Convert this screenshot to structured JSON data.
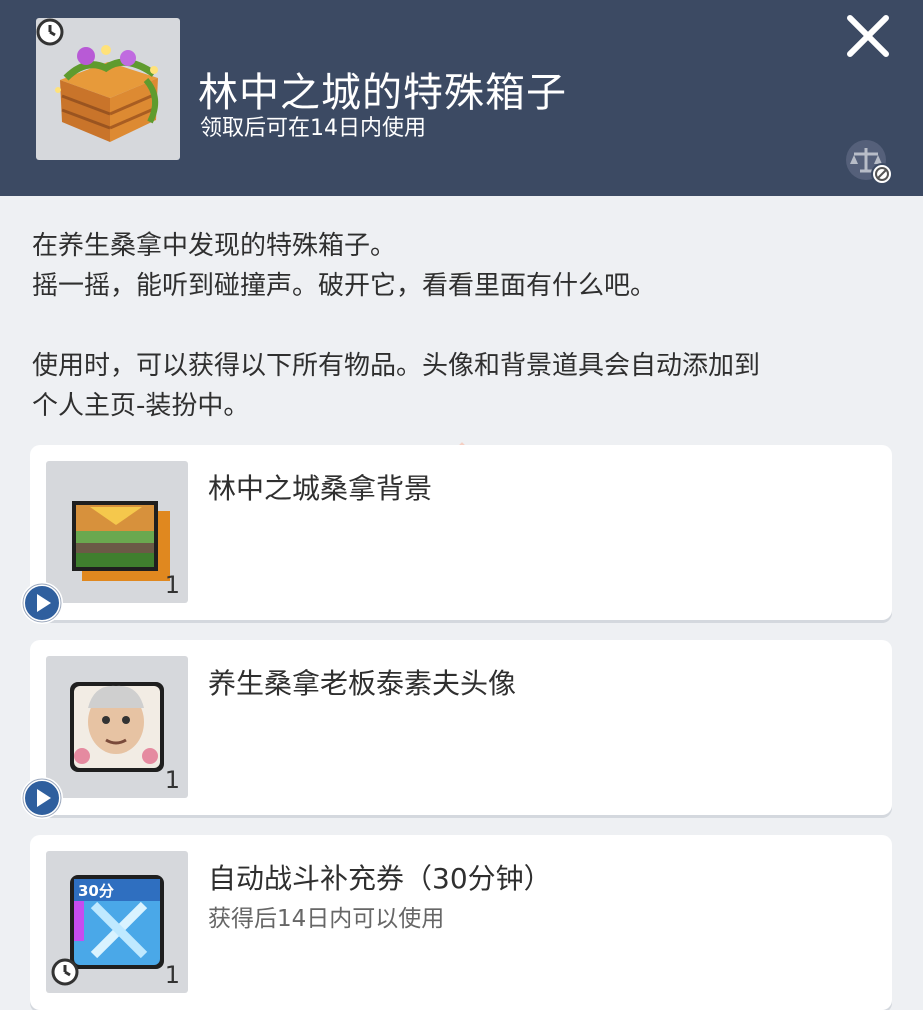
{
  "header": {
    "title": "林中之城的特殊箱子",
    "subtitle": "领取后可在14日内使用",
    "item_icon": "treasure-box-icon",
    "close_icon": "close-icon",
    "trade_icon": "untradeable-scale-icon"
  },
  "description": {
    "line1": "在养生桑拿中发现的特殊箱子。",
    "line2": "摇一摇，能听到碰撞声。破开它，看看里面有什么吧。",
    "line3": "使用时，可以获得以下所有物品。头像和背景道具会自动添加到",
    "line4": "个人主页-装扮中。"
  },
  "rewards": [
    {
      "name": "林中之城桑拿背景",
      "note": "",
      "qty": "1",
      "icon": "background-picture-icon",
      "badge": "play-icon"
    },
    {
      "name": "养生桑拿老板泰素夫头像",
      "note": "",
      "qty": "1",
      "icon": "portrait-avatar-icon",
      "badge": "play-icon"
    },
    {
      "name": "自动战斗补充券（30分钟）",
      "note": "获得后14日内可以使用",
      "qty": "1",
      "icon": "auto-battle-ticket-icon",
      "badge": "clock-icon",
      "ticket_label": "30分"
    }
  ],
  "colors": {
    "header_bg": "#3c4a63",
    "page_bg": "#eef0f3",
    "card_bg": "#ffffff",
    "thumb_bg": "#d6d8dc",
    "play_badge": "#2f5f9e"
  }
}
